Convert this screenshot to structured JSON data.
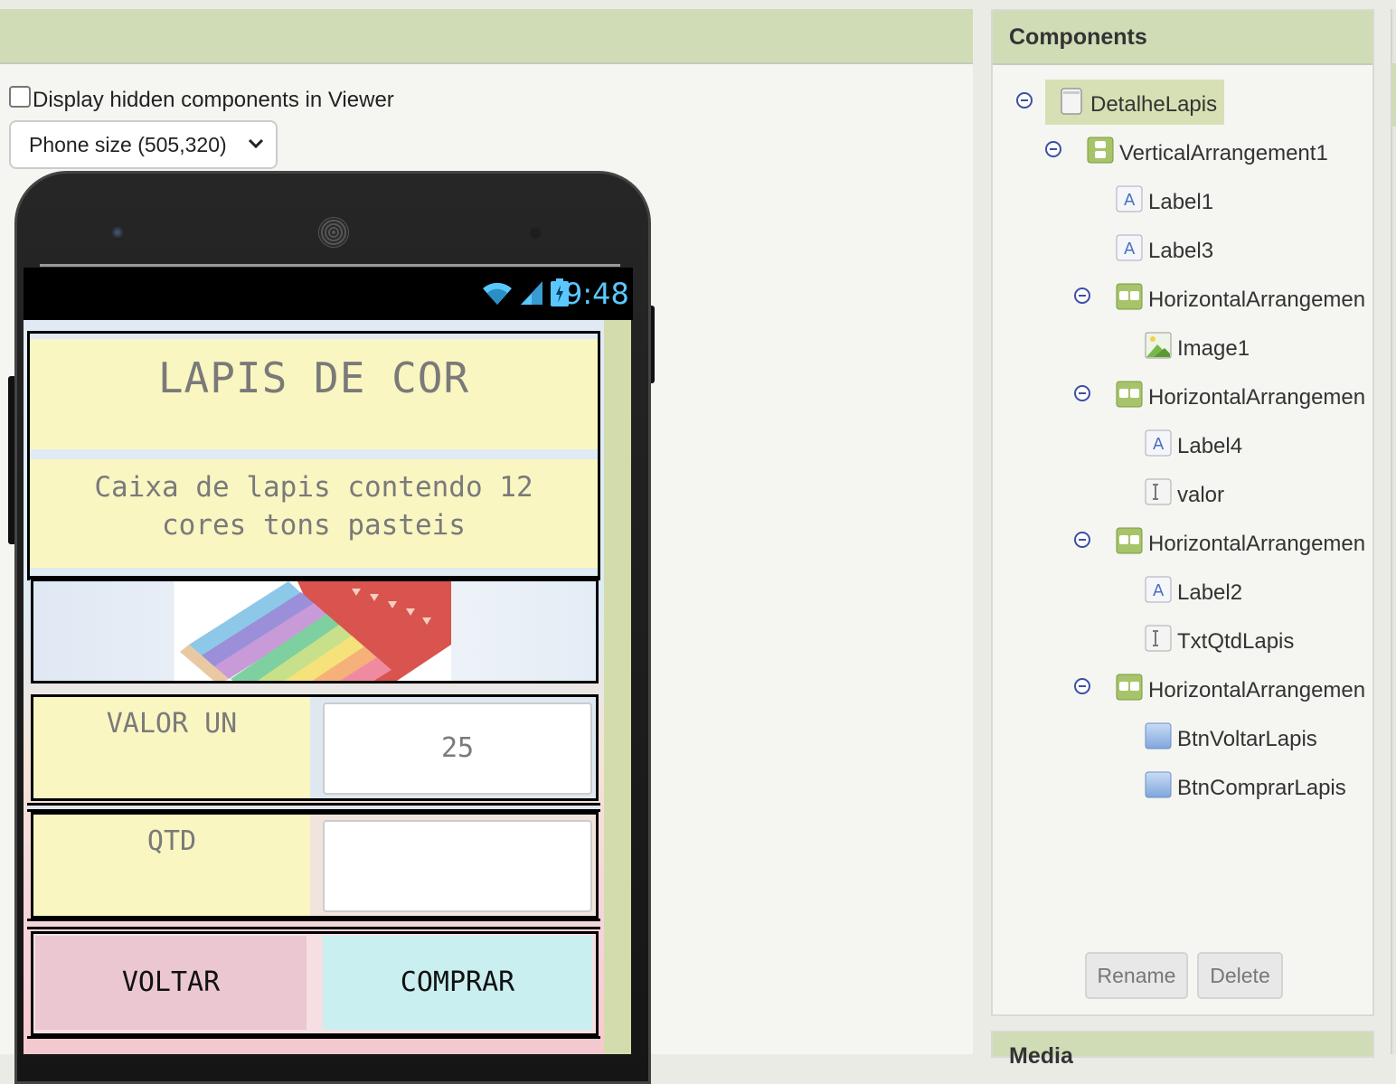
{
  "viewer": {
    "hidden_components_label": "Display hidden components in Viewer",
    "phone_size_selected": "Phone size (505,320)"
  },
  "status_bar": {
    "time": "9:48"
  },
  "app": {
    "title": "LAPIS DE COR",
    "subtitle_line1": "Caixa de lapis contendo 12",
    "subtitle_line2": "cores tons pasteis",
    "valor_label": "VALOR UN",
    "valor_value": "25",
    "qtd_label": "QTD",
    "qtd_value": "",
    "voltar_button": "VOLTAR",
    "comprar_button": "COMPRAR"
  },
  "components": {
    "title": "Components",
    "tree": [
      {
        "name": "DetalheLapis",
        "icon": "screen-icon",
        "selected": true
      },
      {
        "name": "VerticalArrangement1",
        "icon": "vertical-arrangement-icon"
      },
      {
        "name": "Label1",
        "icon": "label-icon"
      },
      {
        "name": "Label3",
        "icon": "label-icon"
      },
      {
        "name": "HorizontalArrangemen",
        "icon": "horizontal-arrangement-icon"
      },
      {
        "name": "Image1",
        "icon": "image-icon"
      },
      {
        "name": "HorizontalArrangemen",
        "icon": "horizontal-arrangement-icon"
      },
      {
        "name": "Label4",
        "icon": "label-icon"
      },
      {
        "name": "valor",
        "icon": "textbox-icon"
      },
      {
        "name": "HorizontalArrangemen",
        "icon": "horizontal-arrangement-icon"
      },
      {
        "name": "Label2",
        "icon": "label-icon"
      },
      {
        "name": "TxtQtdLapis",
        "icon": "textbox-icon"
      },
      {
        "name": "HorizontalArrangemen",
        "icon": "horizontal-arrangement-icon"
      },
      {
        "name": "BtnVoltarLapis",
        "icon": "button-icon"
      },
      {
        "name": "BtnComprarLapis",
        "icon": "button-icon"
      }
    ],
    "rename_button": "Rename",
    "delete_button": "Delete"
  },
  "media": {
    "title": "Media"
  },
  "colors": {
    "header_green": "#cfdcb6",
    "label_yellow": "#faf6c2",
    "voltar_pink": "#ebc7d2",
    "comprar_cyan": "#c9eff0",
    "status_time_blue": "#5ac8ff"
  }
}
